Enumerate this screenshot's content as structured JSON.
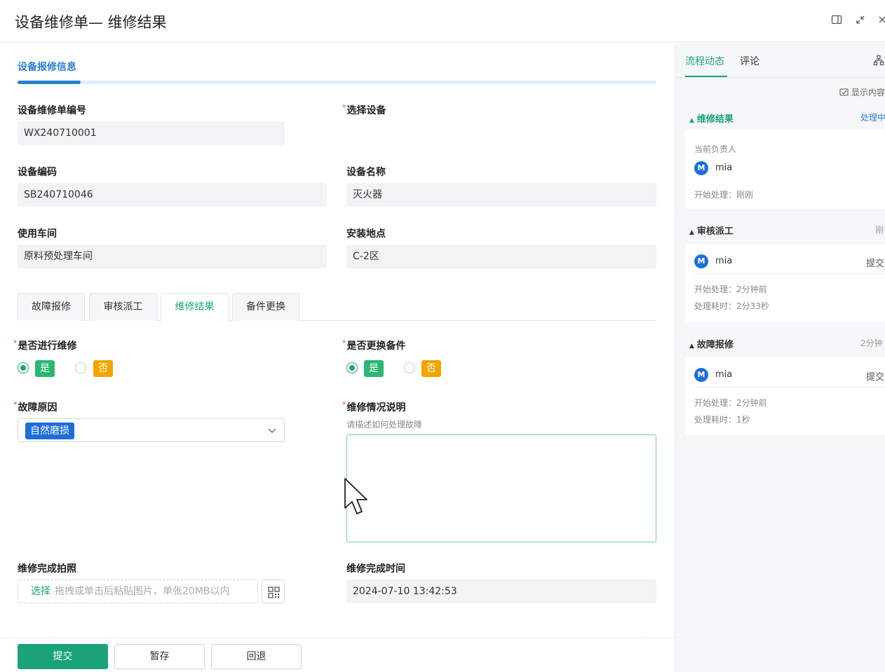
{
  "window": {
    "title": "设备维修单— 维修结果"
  },
  "section": {
    "tab": "设备报修信息"
  },
  "form": {
    "order_no": {
      "label": "设备维修单编号",
      "value": "WX240710001"
    },
    "select_device": {
      "label": "选择设备",
      "required": "*"
    },
    "device_code": {
      "label": "设备编码",
      "value": "SB240710046"
    },
    "device_name": {
      "label": "设备名称",
      "value": "灭火器"
    },
    "workshop": {
      "label": "使用车间",
      "value": "原料预处理车间"
    },
    "location": {
      "label": "安装地点",
      "value": "C-2区"
    }
  },
  "tabs": [
    "故障报修",
    "审核派工",
    "维修结果",
    "备件更换"
  ],
  "result": {
    "do_repair": {
      "label": "是否进行维修",
      "yes": "是",
      "no": "否",
      "selected": "是"
    },
    "replace_parts": {
      "label": "是否更换备件",
      "yes": "是",
      "no": "否",
      "selected": "是"
    },
    "cause": {
      "label": "故障原因",
      "value": "自然磨损"
    },
    "description": {
      "label": "维修情况说明",
      "hint": "请描述如何处理故障",
      "value": ""
    },
    "photo": {
      "label": "维修完成拍照",
      "pick": "选择",
      "placeholder": "拖拽或单击后粘贴图片，单张20MB以内"
    },
    "finish_time": {
      "label": "维修完成时间",
      "value": "2024-07-10 13:42:53"
    }
  },
  "footer": {
    "submit": "提交",
    "save": "暂存",
    "back": "回退"
  },
  "side": {
    "tabs": [
      "流程动态",
      "评论"
    ],
    "show_content": "显示内容",
    "groups": [
      {
        "title": "维修结果",
        "status": "处理中",
        "owner_label": "当前负责人",
        "user": "mia",
        "avatar": "M",
        "start": "开始处理：刚刚"
      },
      {
        "title": "审核派工",
        "status": "刚",
        "user": "mia",
        "avatar": "M",
        "action": "提交",
        "start": "开始处理：2分钟前",
        "duration": "处理耗时：2分33秒"
      },
      {
        "title": "故障报修",
        "status": "2分钟",
        "user": "mia",
        "avatar": "M",
        "action": "提交",
        "start": "开始处理：2分钟前",
        "duration": "处理耗时：1秒"
      }
    ]
  },
  "colors": {
    "accent": "#1aa37a",
    "blue": "#1d6fd6",
    "yes": "#2bb673",
    "no": "#f0a500"
  }
}
